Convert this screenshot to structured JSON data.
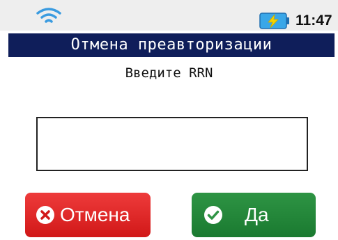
{
  "status_bar": {
    "time": "11:47",
    "wifi_icon": "wifi-icon",
    "battery_icon": "battery-charging-icon"
  },
  "screen": {
    "title": "Отмена преавторизации",
    "prompt": "Введите RRN"
  },
  "rrn_input": {
    "value": "",
    "placeholder": ""
  },
  "buttons": {
    "cancel_label": "Отмена",
    "cancel_icon": "x-circle-icon",
    "ok_label": "Да",
    "ok_icon": "check-circle-icon"
  },
  "colors": {
    "title_bar": "#0f1e5a",
    "cancel": "#e02a2a",
    "ok": "#238a3c",
    "battery": "#3aa7e8",
    "bolt": "#f5d300",
    "wifi": "#3a9be0"
  }
}
